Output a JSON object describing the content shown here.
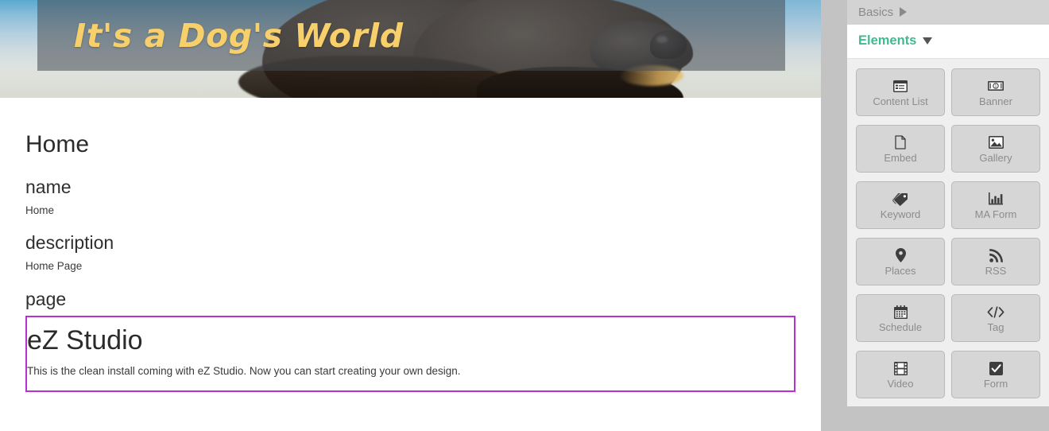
{
  "preview": {
    "hero": {
      "title": "It's a Dog's World",
      "title_color": "#f7cf6b",
      "overlay_color": "rgba(72,76,82,0.56)",
      "image_description": "close-up photograph of a dark long-haired dog's head and snout against a blue sky"
    },
    "page_heading": "Home",
    "fields": [
      {
        "label": "name",
        "value": "Home"
      },
      {
        "label": "description",
        "value": "Home Page"
      }
    ],
    "page_field_label": "page",
    "selected_zone": {
      "heading": "eZ Studio",
      "text": "This is the clean install coming with eZ Studio. Now you can start creating your own design.",
      "highlight_color": "#b82fd2"
    }
  },
  "side_panel": {
    "sections": [
      {
        "label": "Basics",
        "state": "collapsed",
        "icon": "chevron-right-icon"
      },
      {
        "label": "Elements",
        "state": "open",
        "icon": "chevron-down-icon",
        "accent_color": "#3fba92"
      }
    ],
    "elements": [
      {
        "label": "Content List",
        "icon": "content-list-icon"
      },
      {
        "label": "Banner",
        "icon": "banner-icon"
      },
      {
        "label": "Embed",
        "icon": "embed-icon"
      },
      {
        "label": "Gallery",
        "icon": "gallery-icon"
      },
      {
        "label": "Keyword",
        "icon": "keyword-icon"
      },
      {
        "label": "MA Form",
        "icon": "ma-form-icon"
      },
      {
        "label": "Places",
        "icon": "places-icon"
      },
      {
        "label": "RSS",
        "icon": "rss-icon"
      },
      {
        "label": "Schedule",
        "icon": "schedule-icon"
      },
      {
        "label": "Tag",
        "icon": "tag-icon"
      },
      {
        "label": "Video",
        "icon": "video-icon"
      },
      {
        "label": "Form",
        "icon": "form-icon"
      }
    ]
  }
}
